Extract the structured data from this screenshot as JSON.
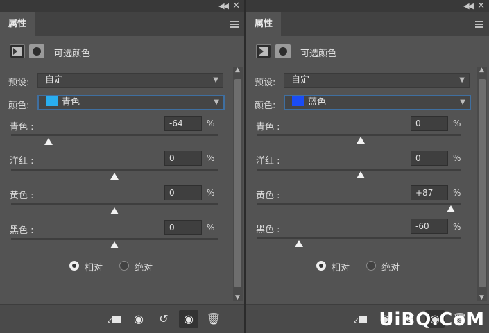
{
  "panels": [
    {
      "tab_label": "属性",
      "title": "可选颜色",
      "preset_label": "预设:",
      "preset_value": "自定",
      "color_label": "颜色:",
      "color_value": "青色",
      "color_swatch": "#29aef0",
      "sliders": [
        {
          "label": "青色 :",
          "value": "-64",
          "unit": "%",
          "percent": -64
        },
        {
          "label": "洋红 :",
          "value": "0",
          "unit": "%",
          "percent": 0
        },
        {
          "label": "黄色 :",
          "value": "0",
          "unit": "%",
          "percent": 0
        },
        {
          "label": "黑色 :",
          "value": "0",
          "unit": "%",
          "percent": 0
        }
      ],
      "method_relative": "相对",
      "method_absolute": "绝对",
      "method_selected": "relative"
    },
    {
      "tab_label": "属性",
      "title": "可选颜色",
      "preset_label": "预设:",
      "preset_value": "自定",
      "color_label": "颜色:",
      "color_value": "蓝色",
      "color_swatch": "#1a4cf5",
      "sliders": [
        {
          "label": "青色 :",
          "value": "0",
          "unit": "%",
          "percent": 0
        },
        {
          "label": "洋红 :",
          "value": "0",
          "unit": "%",
          "percent": 0
        },
        {
          "label": "黄色 :",
          "value": "+87",
          "unit": "%",
          "percent": 87
        },
        {
          "label": "黑色 :",
          "value": "-60",
          "unit": "%",
          "percent": -60
        }
      ],
      "method_relative": "相对",
      "method_absolute": "绝对",
      "method_selected": "relative"
    }
  ],
  "icons": {
    "collapse": "collapse-arrows-icon",
    "close": "close-icon",
    "panel_menu": "panel-menu-icon",
    "clip_to_layer": "clip-to-layer-icon",
    "view_previous": "view-previous-state-icon",
    "reset": "reset-icon",
    "visibility": "eye-icon",
    "delete": "trash-icon"
  },
  "watermark": "UiBQ.CoM"
}
